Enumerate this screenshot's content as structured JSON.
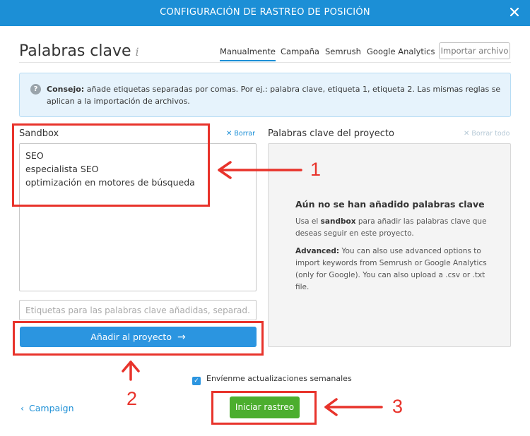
{
  "window": {
    "title": "CONFIGURACIÓN DE RASTREO DE POSICIÓN",
    "close_icon": "close-icon"
  },
  "header": {
    "title": "Palabras clave",
    "info_glyph": "i",
    "tabs": [
      {
        "label": "Manualmente",
        "active": true
      },
      {
        "label": "Campaña",
        "active": false
      },
      {
        "label": "Semrush",
        "active": false
      },
      {
        "label": "Google Analytics",
        "active": false
      }
    ],
    "import_button": "Importar archivo"
  },
  "tip": {
    "icon": "question-icon",
    "label": "Consejo:",
    "text": "añade etiquetas separadas por comas. Por ej.: palabra clave, etiqueta 1, etiqueta 2. Las mismas reglas se aplican a la importación de archivos."
  },
  "sandbox": {
    "label": "Sandbox",
    "clear_link": "Borrar",
    "keywords": [
      "SEO",
      "especialista SEO",
      "optimización en motores de búsqueda"
    ],
    "tags_placeholder": "Etiquetas para las palabras clave añadidas, separad…",
    "add_button": "Añadir al proyecto"
  },
  "project": {
    "label": "Palabras clave del proyecto",
    "clear_all_link": "Borrar todo",
    "empty_title": "Aún no se han añadido palabras clave",
    "empty_p1_pre": "Usa el",
    "empty_p1_bold": "sandbox",
    "empty_p1_post": "para añadir las palabras clave que deseas seguir en este proyecto.",
    "empty_p2_bold": "Advanced:",
    "empty_p2_text": "You can also use advanced options to import keywords from Semrush or Google Analytics (only for Google). You can also upload a .csv or .txt file."
  },
  "footer": {
    "checkbox_label": "Envíenme actualizaciones semanales",
    "checkbox_checked": true,
    "back_link": "Campaign",
    "start_button": "Iniciar rastreo"
  },
  "annotations": {
    "one": "1",
    "two": "2",
    "three": "3",
    "color": "#e8332b"
  },
  "colors": {
    "titlebar": "#1c8fd6",
    "primary": "#2b95e0",
    "success": "#4cae2e",
    "tip_bg": "#e6f3fc"
  }
}
